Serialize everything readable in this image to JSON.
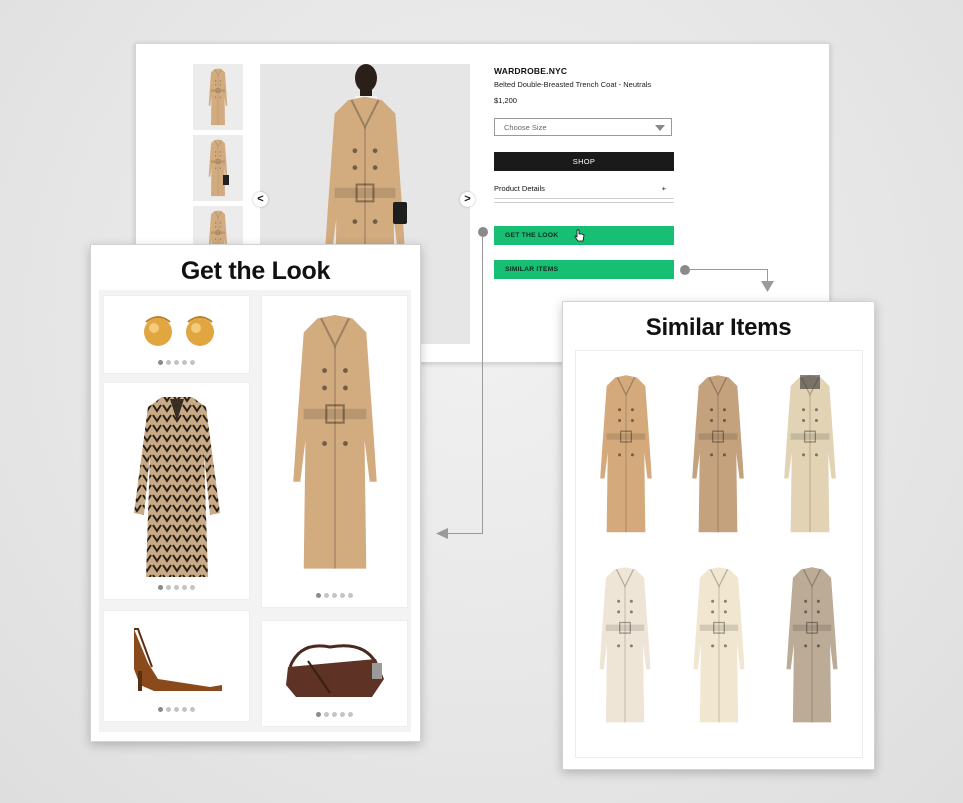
{
  "product": {
    "brand": "WARDROBE.NYC",
    "name": "Belted Double-Breasted Trench Coat - Neutrals",
    "price": "$1,200",
    "size_placeholder": "Choose Size",
    "shop_label": "SHOP",
    "details_label": "Product Details",
    "details_toggle": "+",
    "prev_arrow": "<",
    "next_arrow": ">"
  },
  "buttons": {
    "get_the_look": "GET THE LOOK",
    "similar_items": "SIMILAR ITEMS"
  },
  "get_the_look_card": {
    "title": "Get the Look",
    "items": [
      "gold-earrings",
      "printed-silk-dress",
      "trench-coat",
      "slingback-pump",
      "leather-shoulder-bag"
    ],
    "pager_count": 5,
    "pager_active": 0
  },
  "similar_items_card": {
    "title": "Similar Items",
    "items": [
      "camel-trench",
      "tan-belted-trench",
      "beige-trench-print-collar",
      "cream-trench",
      "ivory-trench",
      "mushroom-trench"
    ]
  },
  "colors": {
    "accent_green": "#16bf73",
    "shop_black": "#1a1a1a",
    "camel": "#d2ab7f"
  }
}
